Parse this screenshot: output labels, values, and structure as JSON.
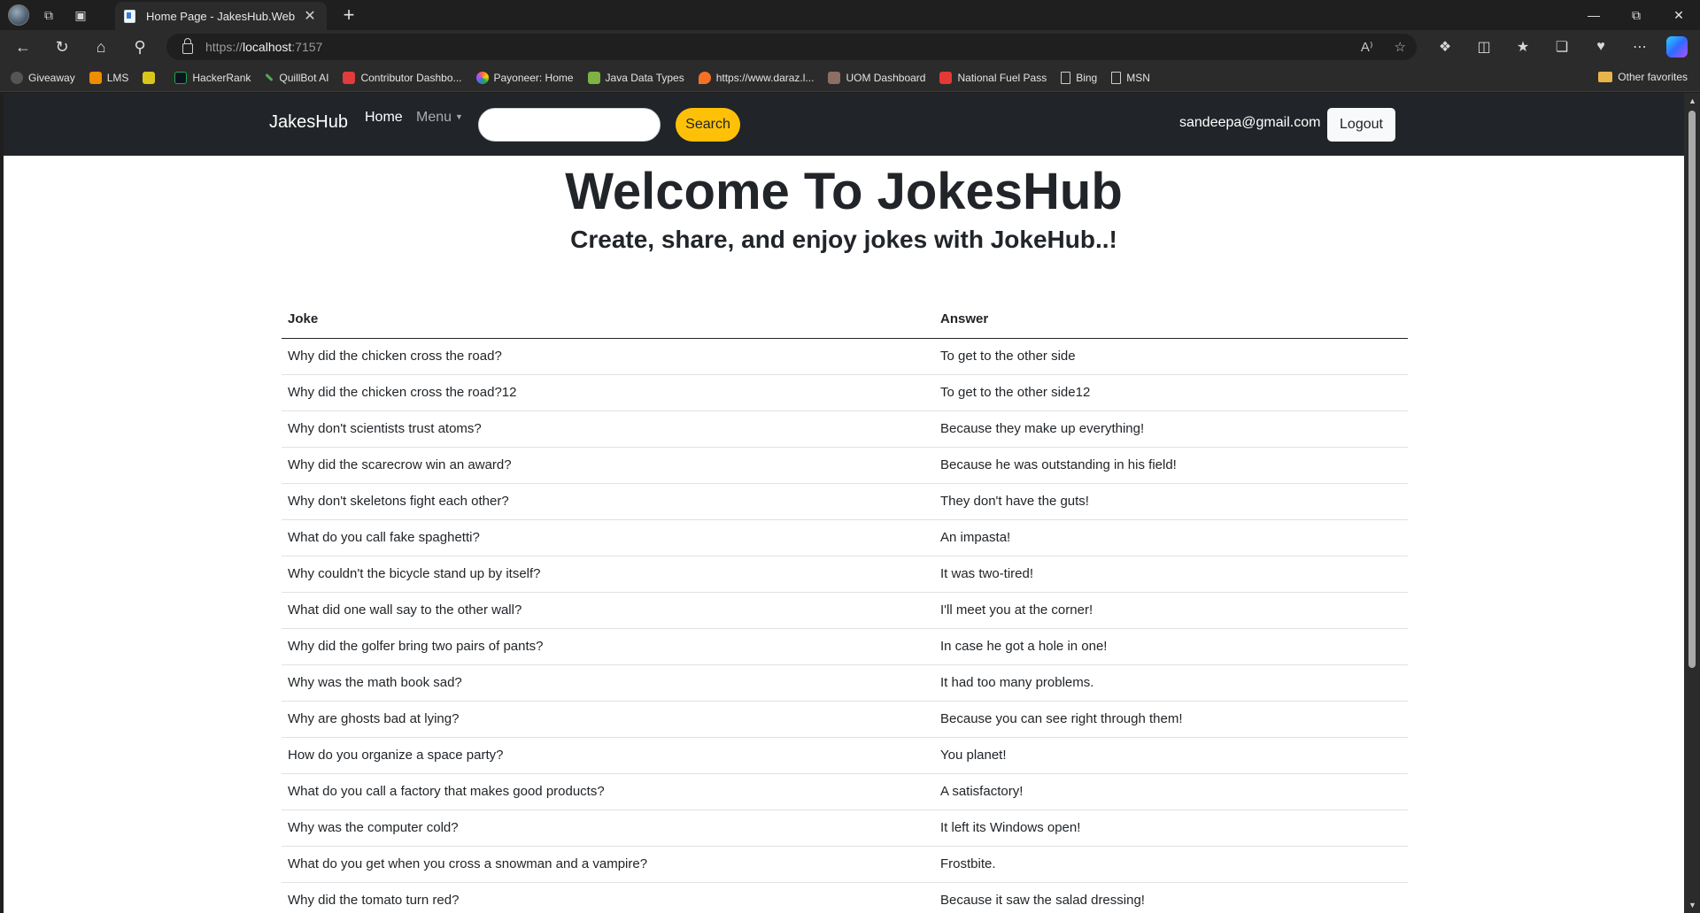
{
  "browser": {
    "tab_title": "Home Page - JakesHub.Web",
    "url_scheme": "https://",
    "url_host": "localhost",
    "url_port": ":7157",
    "bookmarks": [
      {
        "label": "Giveaway",
        "color": "#555555"
      },
      {
        "label": "LMS",
        "color": "#f08c00"
      },
      {
        "label": "",
        "color": "#d9c51c"
      },
      {
        "label": "HackerRank",
        "color": "#1ba94c"
      },
      {
        "label": "QuillBot AI",
        "color": "#4caf50"
      },
      {
        "label": "Contributor Dashbo...",
        "color": "#e23b3b"
      },
      {
        "label": "Payoneer: Home",
        "color": "#ff6b35"
      },
      {
        "label": "Java Data Types",
        "color": "#7cb342"
      },
      {
        "label": "https://www.daraz.l...",
        "color": "#f57224"
      },
      {
        "label": "UOM Dashboard",
        "color": "#8d6e63"
      },
      {
        "label": "National Fuel Pass",
        "color": "#e53935"
      },
      {
        "label": "Bing",
        "color": "#cfcfcf"
      },
      {
        "label": "MSN",
        "color": "#cfcfcf"
      }
    ],
    "other_favorites": "Other favorites"
  },
  "navbar": {
    "brand": "JakesHub",
    "home": "Home",
    "menu": "Menu",
    "search_button": "Search",
    "user_email": "sandeepa@gmail.com",
    "logout": "Logout"
  },
  "hero": {
    "title": "Welcome To JokesHub",
    "subtitle": "Create, share, and enjoy jokes with JokeHub..!"
  },
  "table": {
    "headers": {
      "joke": "Joke",
      "answer": "Answer"
    },
    "rows": [
      {
        "joke": "Why did the chicken cross the road?",
        "answer": "To get to the other side"
      },
      {
        "joke": "Why did the chicken cross the road?12",
        "answer": "To get to the other side12"
      },
      {
        "joke": "Why don't scientists trust atoms?",
        "answer": "Because they make up everything!"
      },
      {
        "joke": "Why did the scarecrow win an award?",
        "answer": "Because he was outstanding in his field!"
      },
      {
        "joke": "Why don't skeletons fight each other?",
        "answer": "They don't have the guts!"
      },
      {
        "joke": "What do you call fake spaghetti?",
        "answer": "An impasta!"
      },
      {
        "joke": "Why couldn't the bicycle stand up by itself?",
        "answer": "It was two-tired!"
      },
      {
        "joke": "What did one wall say to the other wall?",
        "answer": "I'll meet you at the corner!"
      },
      {
        "joke": "Why did the golfer bring two pairs of pants?",
        "answer": "In case he got a hole in one!"
      },
      {
        "joke": "Why was the math book sad?",
        "answer": "It had too many problems."
      },
      {
        "joke": "Why are ghosts bad at lying?",
        "answer": "Because you can see right through them!"
      },
      {
        "joke": "How do you organize a space party?",
        "answer": "You planet!"
      },
      {
        "joke": "What do you call a factory that makes good products?",
        "answer": "A satisfactory!"
      },
      {
        "joke": "Why was the computer cold?",
        "answer": "It left its Windows open!"
      },
      {
        "joke": "What do you get when you cross a snowman and a vampire?",
        "answer": "Frostbite."
      },
      {
        "joke": "Why did the tomato turn red?",
        "answer": "Because it saw the salad dressing!"
      }
    ]
  }
}
